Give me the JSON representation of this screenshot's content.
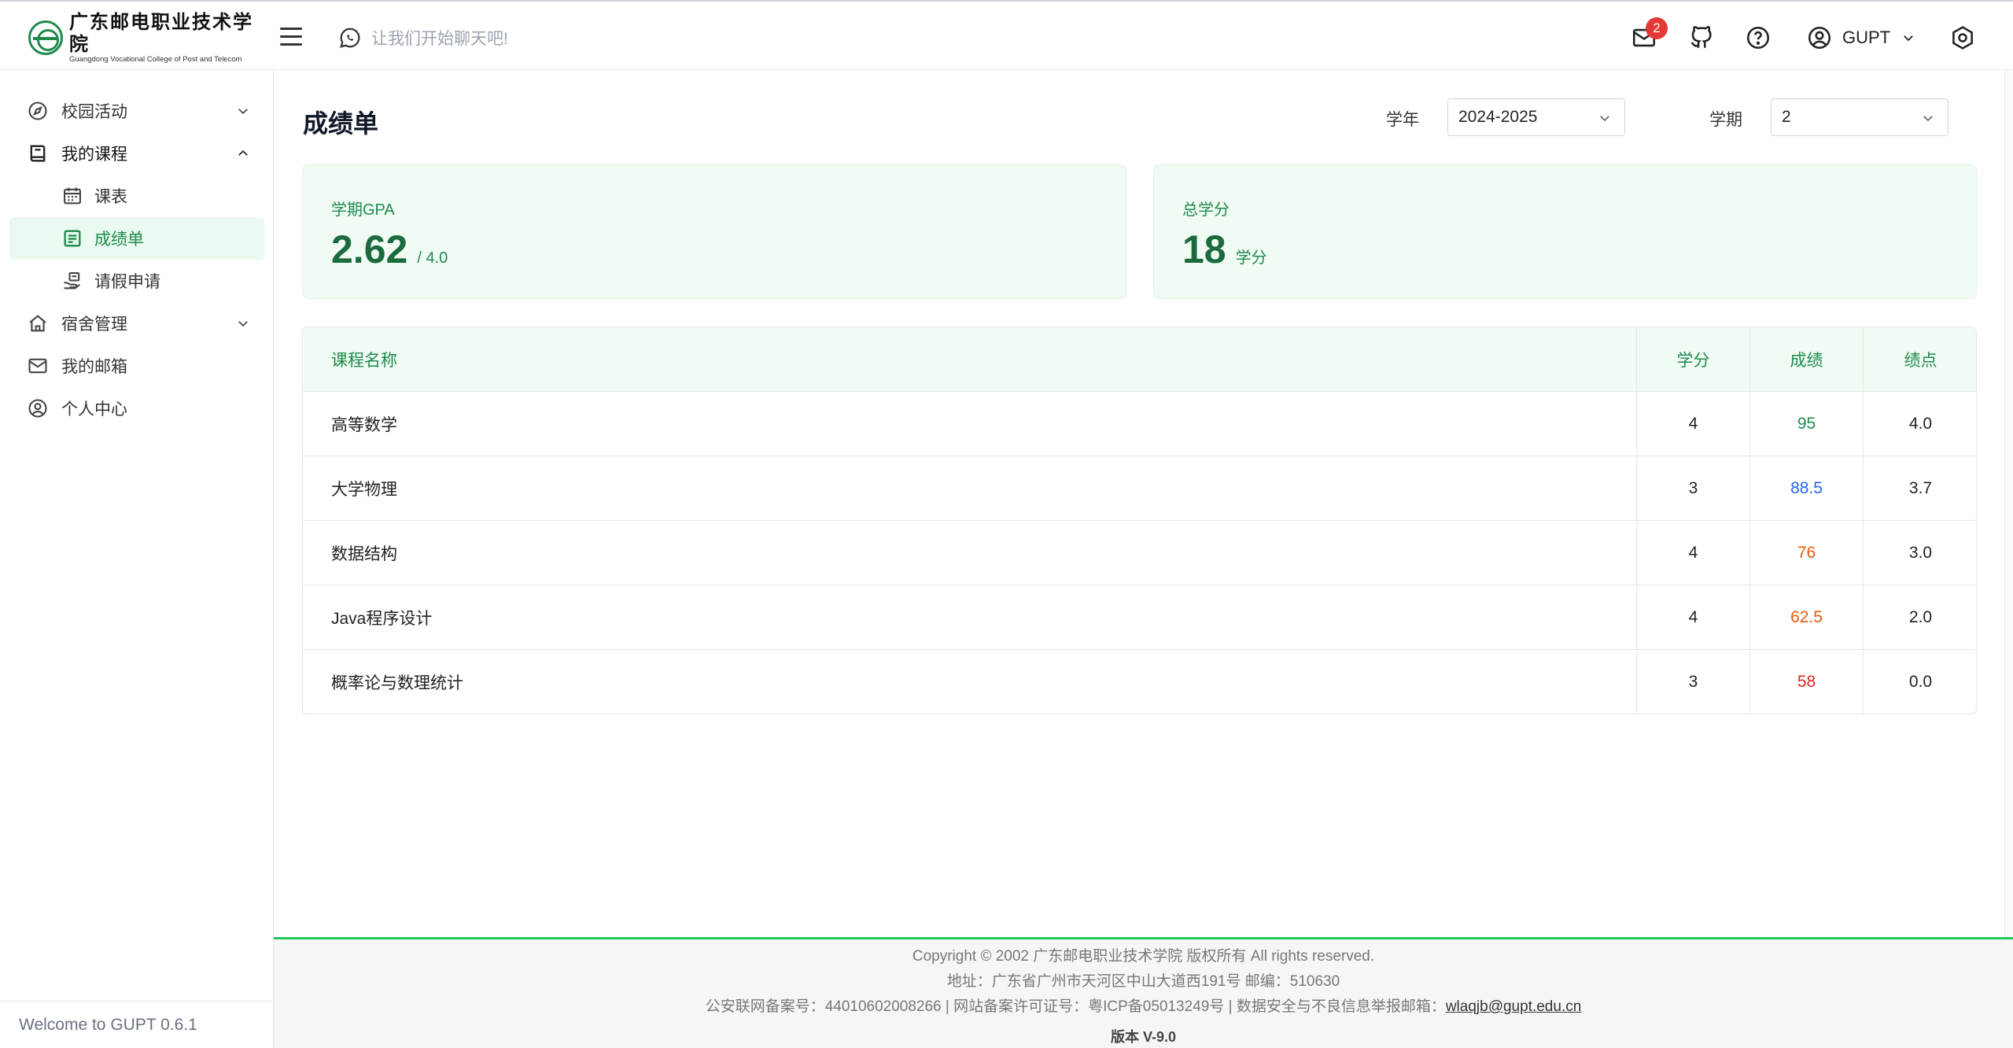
{
  "header": {
    "logo_cn": "广东邮电职业技术学院",
    "logo_en": "Guangdong Vocational College of Post and Telecom",
    "chat_placeholder": "让我们开始聊天吧!",
    "mail_badge": "2",
    "user_name": "GUPT"
  },
  "sidebar": {
    "items": [
      {
        "label": "校园活动",
        "icon": "compass-icon"
      },
      {
        "label": "我的课程",
        "icon": "book-icon"
      },
      {
        "label": "课表",
        "icon": "calendar-icon"
      },
      {
        "label": "成绩单",
        "icon": "report-icon"
      },
      {
        "label": "请假申请",
        "icon": "hand-icon"
      },
      {
        "label": "宿舍管理",
        "icon": "home-icon"
      },
      {
        "label": "我的邮箱",
        "icon": "mail-icon"
      },
      {
        "label": "个人中心",
        "icon": "user-circle-icon"
      }
    ],
    "welcome": "Welcome to GUPT 0.6.1"
  },
  "main": {
    "title": "成绩单",
    "year_label": "学年",
    "year_value": "2024-2025",
    "term_label": "学期",
    "term_value": "2",
    "gpa_card": {
      "label": "学期GPA",
      "value": "2.62",
      "suffix": "/ 4.0"
    },
    "credit_card": {
      "label": "总学分",
      "value": "18",
      "suffix": "学分"
    },
    "table": {
      "headers": [
        "课程名称",
        "学分",
        "成绩",
        "绩点"
      ],
      "rows": [
        {
          "name": "高等数学",
          "credit": "4",
          "score": "95",
          "gpa": "4.0"
        },
        {
          "name": "大学物理",
          "credit": "3",
          "score": "88.5",
          "gpa": "3.7"
        },
        {
          "name": "数据结构",
          "credit": "4",
          "score": "76",
          "gpa": "3.0"
        },
        {
          "name": "Java程序设计",
          "credit": "4",
          "score": "62.5",
          "gpa": "2.0"
        },
        {
          "name": "概率论与数理统计",
          "credit": "3",
          "score": "58",
          "gpa": "0.0"
        }
      ]
    }
  },
  "footer": {
    "copyright": "Copyright © 2002 广东邮电职业技术学院 版权所有 All rights reserved.",
    "address": "地址：广东省广州市天河区中山大道西191号 邮编：510630",
    "record_prefix": "公安联网备案号：44010602008266 | 网站备案许可证号：粤ICP备05013249号 | 数据安全与不良信息举报邮箱：",
    "email": "wlaqjb@gupt.edu.cn",
    "version": "版本 V-9.0"
  },
  "colors": {
    "brand_green": "#1f8a4c",
    "score_excellent": "#1f8a4c",
    "score_good": "#2563eb",
    "score_mid": "#ea580c",
    "score_pass": "#ea580c",
    "score_fail": "#dc2626",
    "badge": "#e53935"
  }
}
